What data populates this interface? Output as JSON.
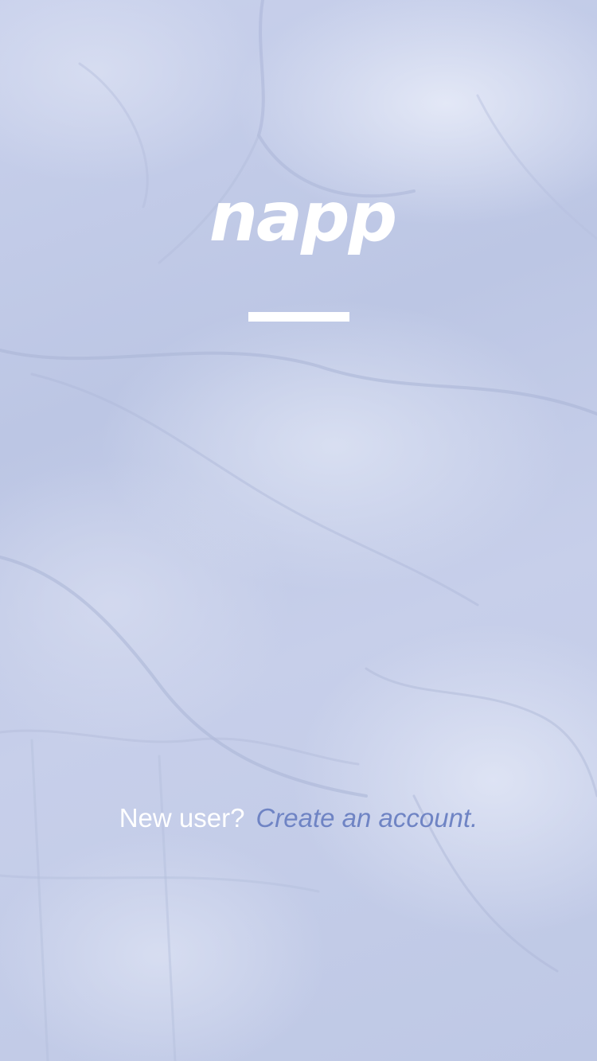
{
  "app": {
    "logo_text": "napp"
  },
  "signup": {
    "prompt": "New user?",
    "link_label": "Create an account."
  },
  "colors": {
    "background_tint": "#c3cbe6",
    "logo": "#ffffff",
    "divider": "#ffffff",
    "prompt_text": "#ffffff",
    "link_text": "#6f84c4"
  },
  "background": {
    "icon": "crumpled-bedsheet-photo"
  }
}
